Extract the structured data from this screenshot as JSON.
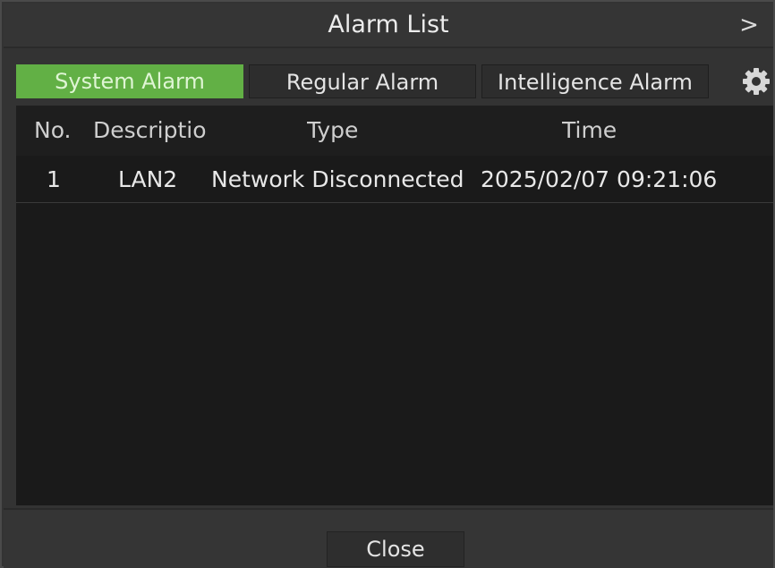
{
  "window": {
    "title": "Alarm List",
    "expand_glyph": ">"
  },
  "tabs": [
    {
      "label": "System Alarm",
      "active": true
    },
    {
      "label": "Regular Alarm",
      "active": false
    },
    {
      "label": "Intelligence Alarm",
      "active": false
    }
  ],
  "settings_icon": "gear-icon",
  "table": {
    "columns": [
      "No.",
      "Descriptio",
      "Type",
      "Time"
    ],
    "rows": [
      {
        "no": "1",
        "description": "LAN2",
        "type": "Network Disconnected",
        "time": "2025/02/07 09:21:06"
      }
    ]
  },
  "footer": {
    "close_label": "Close"
  },
  "colors": {
    "accent": "#62b045",
    "background": "#333333",
    "table_background": "#1a1a1a"
  }
}
